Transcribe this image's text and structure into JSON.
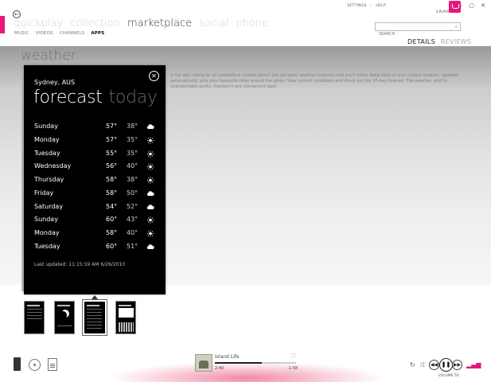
{
  "top_links": {
    "settings": "SETTINGS",
    "help": "HELP"
  },
  "profile": {
    "name": "S PLAYS"
  },
  "window_controls": "– ▢ ✕",
  "nav": {
    "main": [
      {
        "label": "quickplay",
        "active": false
      },
      {
        "label": "collection",
        "active": false
      },
      {
        "label": "marketplace",
        "active": true
      },
      {
        "label": "social",
        "active": false
      },
      {
        "label": "phone",
        "active": false
      }
    ],
    "sub": [
      {
        "label": "MUSIC",
        "active": false
      },
      {
        "label": "VIDEOS",
        "active": false
      },
      {
        "label": "CHANNELS",
        "active": false
      },
      {
        "label": "APPS",
        "active": true
      }
    ]
  },
  "search": {
    "placeholder": "SEARCH"
  },
  "tabs": [
    {
      "label": "DETAILS",
      "active": true
    },
    {
      "label": "REVIEWS",
      "active": false
    }
  ],
  "app": {
    "title": "weather",
    "description": "Is the day calling for an umbrella or suntan lotion? Get pin-point weather forecasts and you'll know. Keep track of your current location, updated automatically, plus your favourite cities around the globe. View current conditions and check out the 10-day forecast. The weather, and its unpredictable quirks, tracked in one convenient spot!"
  },
  "screenshot": {
    "location": "Sydney, AUS",
    "pivot_active": "forecast",
    "pivot_inactive": "today",
    "close_symbol": "✕",
    "forecast": [
      {
        "day": "Sunday",
        "high": "57°",
        "low": "38°",
        "icon": "cloud-icon"
      },
      {
        "day": "Monday",
        "high": "57°",
        "low": "35°",
        "icon": "sun-icon"
      },
      {
        "day": "Tuesday",
        "high": "55°",
        "low": "35°",
        "icon": "sun-icon"
      },
      {
        "day": "Wednesday",
        "high": "56°",
        "low": "40°",
        "icon": "sun-icon"
      },
      {
        "day": "Thursday",
        "high": "58°",
        "low": "38°",
        "icon": "sun-icon"
      },
      {
        "day": "Friday",
        "high": "58°",
        "low": "50°",
        "icon": "cloud-icon"
      },
      {
        "day": "Saturday",
        "high": "54°",
        "low": "52°",
        "icon": "cloud-icon"
      },
      {
        "day": "Sunday",
        "high": "60°",
        "low": "43°",
        "icon": "sun-icon"
      },
      {
        "day": "Monday",
        "high": "58°",
        "low": "40°",
        "icon": "sun-icon"
      },
      {
        "day": "Tuesday",
        "high": "60°",
        "low": "51°",
        "icon": "cloud-icon"
      }
    ],
    "last_updated": "Last updated: 11:15:59 AM 6/26/2010"
  },
  "player": {
    "song_title": "Island Life",
    "elapsed": "2:40",
    "remaining": "-1:58",
    "progress": 0.58,
    "volume_label": "VOLUME 50"
  },
  "colors": {
    "accent": "#e6177a",
    "panel": "#000000"
  }
}
